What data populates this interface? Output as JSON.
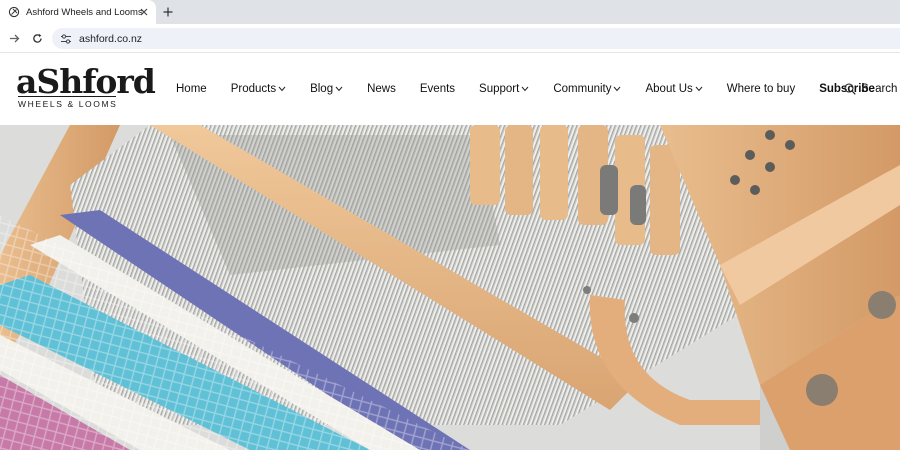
{
  "browser": {
    "tab_title": "Ashford Wheels and Looms",
    "url": "ashford.co.nz"
  },
  "logo": {
    "wordmark": "aShford",
    "tagline": "WHEELS & LOOMS"
  },
  "nav": {
    "items": [
      {
        "label": "Home"
      },
      {
        "label": "Products"
      },
      {
        "label": "Blog"
      },
      {
        "label": "News"
      },
      {
        "label": "Events"
      },
      {
        "label": "Support"
      },
      {
        "label": "Community"
      },
      {
        "label": "About Us"
      },
      {
        "label": "Where to buy"
      },
      {
        "label": "Subscribe"
      }
    ],
    "search_label": "Search"
  },
  "icons": {
    "favicon": "ashford-favicon",
    "tab_close": "close-icon",
    "new_tab": "plus-icon",
    "forward": "arrow-right-icon",
    "reload": "reload-icon",
    "site_info": "tune-icon",
    "search": "search-icon",
    "dropdown": "chevron-down-icon"
  },
  "colors": {
    "tabstrip_bg": "#dfe3e8",
    "omnibox_bg": "#eef1f8",
    "wood": "#e7b98b",
    "weave_purple": "#6e73b5",
    "weave_cyan": "#5fc0d6",
    "weave_pink": "#c77aa8"
  },
  "hero": {
    "alt": "Ashford table loom with woven fabric"
  }
}
